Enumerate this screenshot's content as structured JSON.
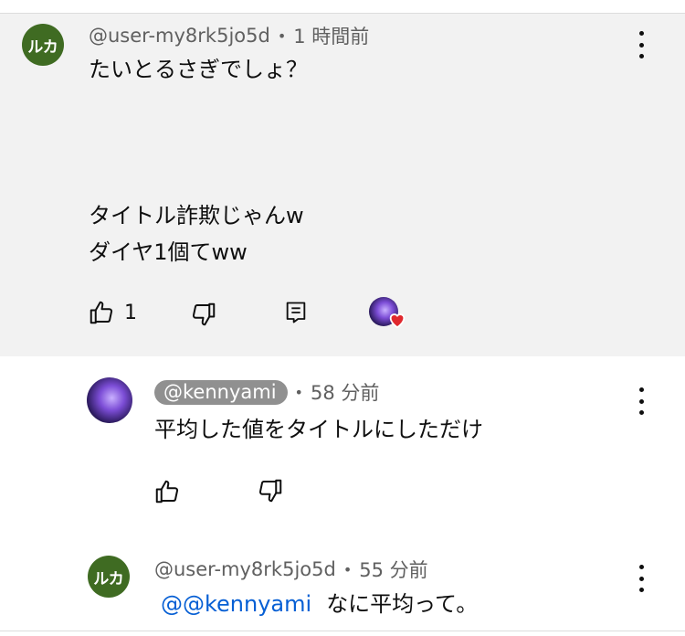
{
  "comments": [
    {
      "avatar_text": "ルカ",
      "handle": "@user-my8rk5jo5d",
      "time": "1 時間前",
      "lines": [
        "たいとるさぎでしょ？",
        "",
        "",
        "",
        "タイトル詐欺じゃんw",
        "ダイヤ1個てww"
      ],
      "like_count": "1"
    },
    {
      "handle": "@kennyami",
      "time": "58 分前",
      "lines": [
        "平均した値をタイトルにしただけ"
      ]
    },
    {
      "avatar_text": "ルカ",
      "handle": "@user-my8rk5jo5d",
      "time": "55 分前",
      "mention": "@@kennyami",
      "text": "なに平均って。"
    }
  ],
  "colors": {
    "highlight_bg": "#f2f2f2",
    "avatar_green": "#3f6b22",
    "mention_blue": "#065fd4",
    "meta_gray": "#606060",
    "heart_red": "#e0282e"
  }
}
